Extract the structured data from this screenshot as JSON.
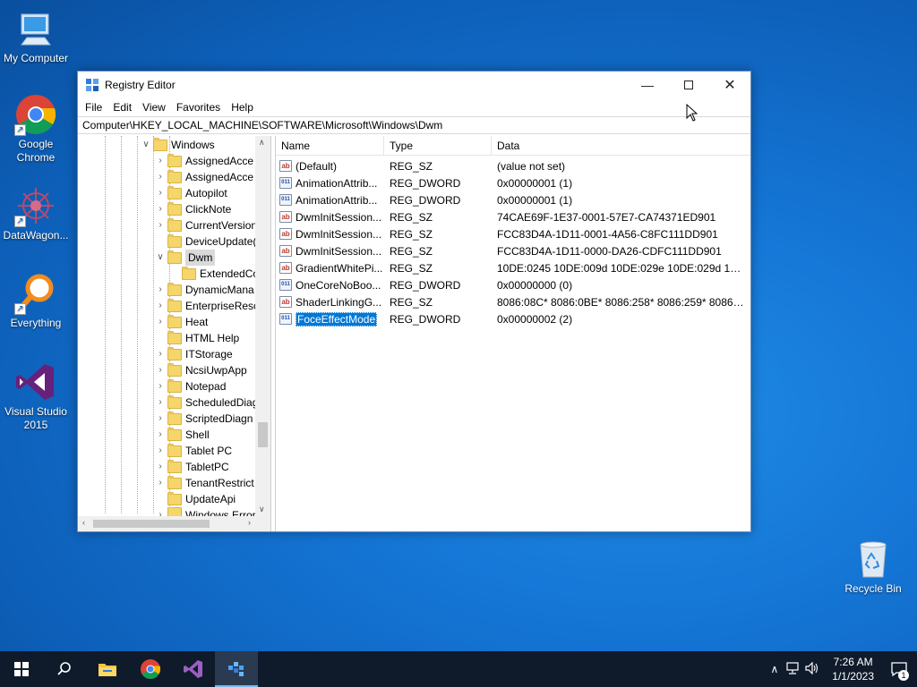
{
  "desktop": {
    "icons": [
      {
        "label": "My Computer"
      },
      {
        "label": "Google Chrome"
      },
      {
        "label": "DataWagon..."
      },
      {
        "label": "Everything"
      },
      {
        "label": "Visual Studio 2015"
      },
      {
        "label": "Recycle Bin"
      }
    ]
  },
  "window": {
    "title": "Registry Editor",
    "menu": [
      "File",
      "Edit",
      "View",
      "Favorites",
      "Help"
    ],
    "address": "Computer\\HKEY_LOCAL_MACHINE\\SOFTWARE\\Microsoft\\Windows\\Dwm",
    "tree": [
      {
        "label": "Windows",
        "expanded": true
      },
      {
        "label": "AssignedAcce"
      },
      {
        "label": "AssignedAcce"
      },
      {
        "label": "Autopilot"
      },
      {
        "label": "ClickNote"
      },
      {
        "label": "CurrentVersion"
      },
      {
        "label": "DeviceUpdate("
      },
      {
        "label": "Dwm",
        "expanded": true,
        "selected": true
      },
      {
        "label": "ExtendedCo"
      },
      {
        "label": "DynamicMana"
      },
      {
        "label": "EnterpriseResc"
      },
      {
        "label": "Heat"
      },
      {
        "label": "HTML Help"
      },
      {
        "label": "ITStorage"
      },
      {
        "label": "NcsiUwpApp"
      },
      {
        "label": "Notepad"
      },
      {
        "label": "ScheduledDiag"
      },
      {
        "label": "ScriptedDiagn"
      },
      {
        "label": "Shell"
      },
      {
        "label": "Tablet PC"
      },
      {
        "label": "TabletPC"
      },
      {
        "label": "TenantRestrict"
      },
      {
        "label": "UpdateApi"
      },
      {
        "label": "Windows Error"
      }
    ],
    "columns": {
      "name": "Name",
      "type": "Type",
      "data": "Data"
    },
    "values": [
      {
        "name": "(Default)",
        "type": "REG_SZ",
        "data": "(value not set)",
        "kind": "sz"
      },
      {
        "name": "AnimationAttrib...",
        "type": "REG_DWORD",
        "data": "0x00000001 (1)",
        "kind": "dw"
      },
      {
        "name": "AnimationAttrib...",
        "type": "REG_DWORD",
        "data": "0x00000001 (1)",
        "kind": "dw"
      },
      {
        "name": "DwmInitSession...",
        "type": "REG_SZ",
        "data": "74CAE69F-1E37-0001-57E7-CA74371ED901",
        "kind": "sz"
      },
      {
        "name": "DwmInitSession...",
        "type": "REG_SZ",
        "data": "FCC83D4A-1D11-0001-4A56-C8FC111DD901",
        "kind": "sz"
      },
      {
        "name": "DwmInitSession...",
        "type": "REG_SZ",
        "data": "FCC83D4A-1D11-0000-DA26-CDFC111DD901",
        "kind": "sz"
      },
      {
        "name": "GradientWhitePi...",
        "type": "REG_SZ",
        "data": "10DE:0245 10DE:009d 10DE:029e 10DE:029d 10DE:02...",
        "kind": "sz"
      },
      {
        "name": "OneCoreNoBoo...",
        "type": "REG_DWORD",
        "data": "0x00000000 (0)",
        "kind": "dw"
      },
      {
        "name": "ShaderLinkingG...",
        "type": "REG_SZ",
        "data": "8086:08C* 8086:0BE* 8086:258* 8086:259* 8086:277*...",
        "kind": "sz"
      },
      {
        "name": "FoceEffectMode",
        "type": "REG_DWORD",
        "data": "0x00000002 (2)",
        "kind": "dw",
        "selected": true
      }
    ]
  },
  "taskbar": {
    "time": "7:26 AM",
    "date": "1/1/2023",
    "notification_count": "1"
  }
}
